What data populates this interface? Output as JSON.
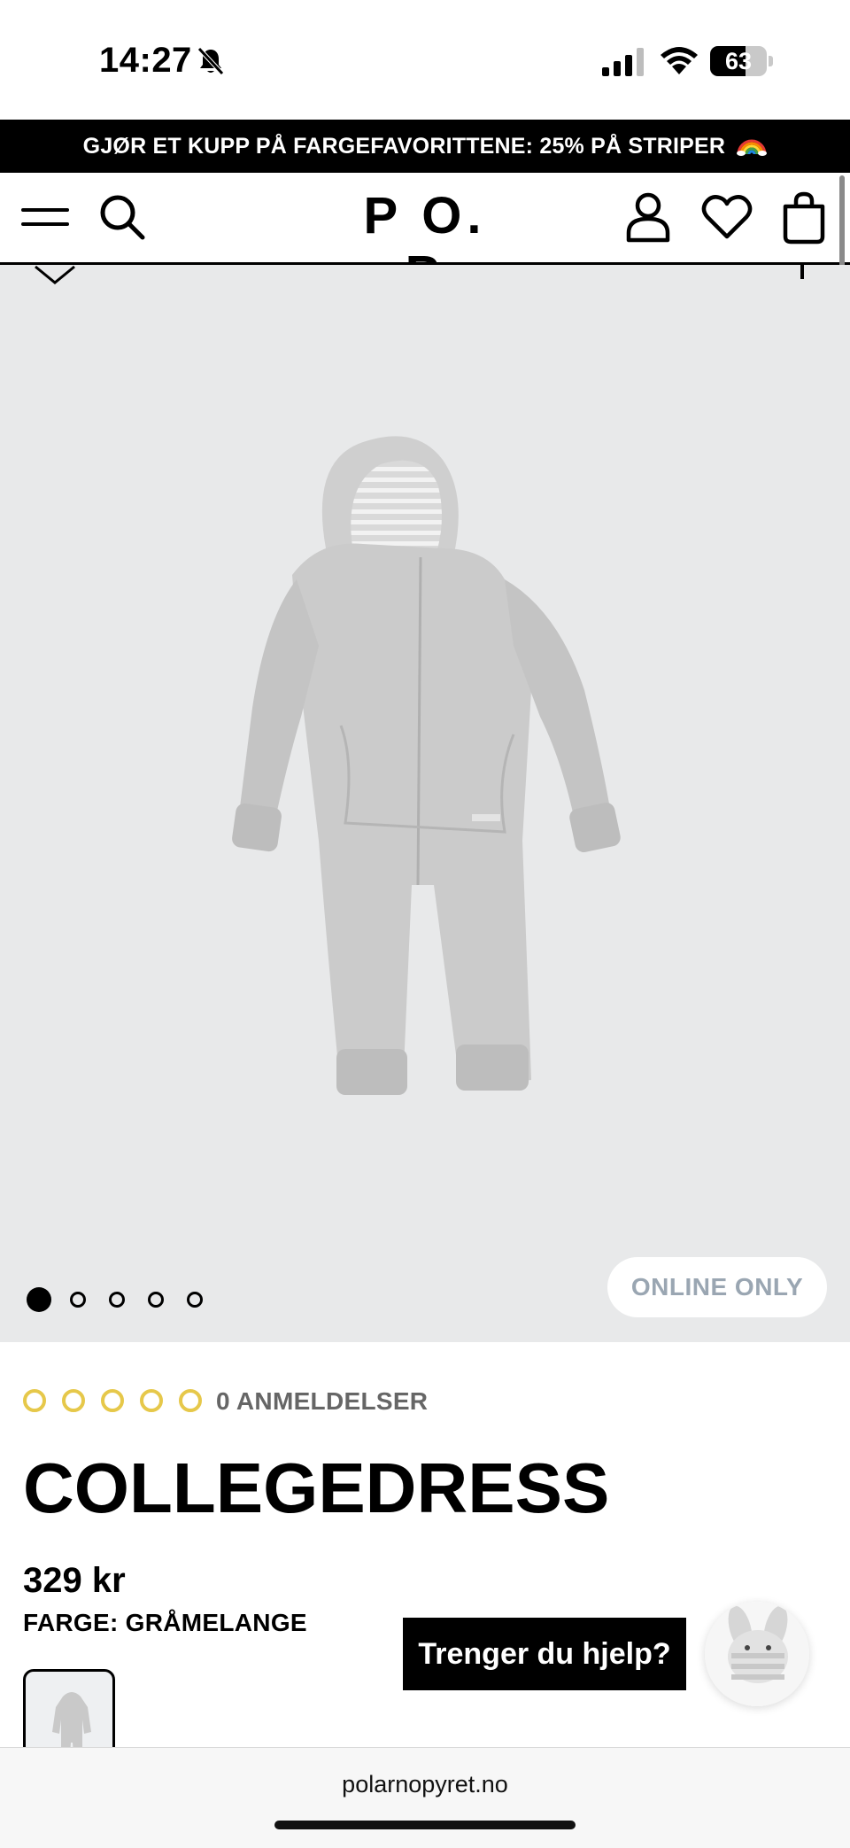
{
  "status_bar": {
    "time": "14:27",
    "battery_text": "63",
    "battery_level": 0.63
  },
  "promo": {
    "text": "GJØR ET KUPP PÅ FARGEFAVORITTENE: 25% PÅ STRIPER",
    "icon": "rainbow-icon"
  },
  "header": {
    "logo": "P O. P",
    "icons": [
      "menu-icon",
      "search-icon",
      "account-icon",
      "heart-icon",
      "bag-icon"
    ]
  },
  "gallery": {
    "image_count": 5,
    "active_index": 0,
    "badge": "ONLINE ONLY"
  },
  "product": {
    "rating_stars": 0,
    "reviews_text": "0 ANMELDELSER",
    "title": "COLLEGEDRESS",
    "price": "329 kr",
    "color_label": "FARGE: GRÅMELANGE"
  },
  "help": {
    "button_label": "Trenger du hjelp?"
  },
  "browser": {
    "url": "polarnopyret.no"
  },
  "colors": {
    "accent_star": "#e6c84a",
    "badge_text": "#9aa6b2",
    "gallery_bg": "#e8e9ea"
  }
}
